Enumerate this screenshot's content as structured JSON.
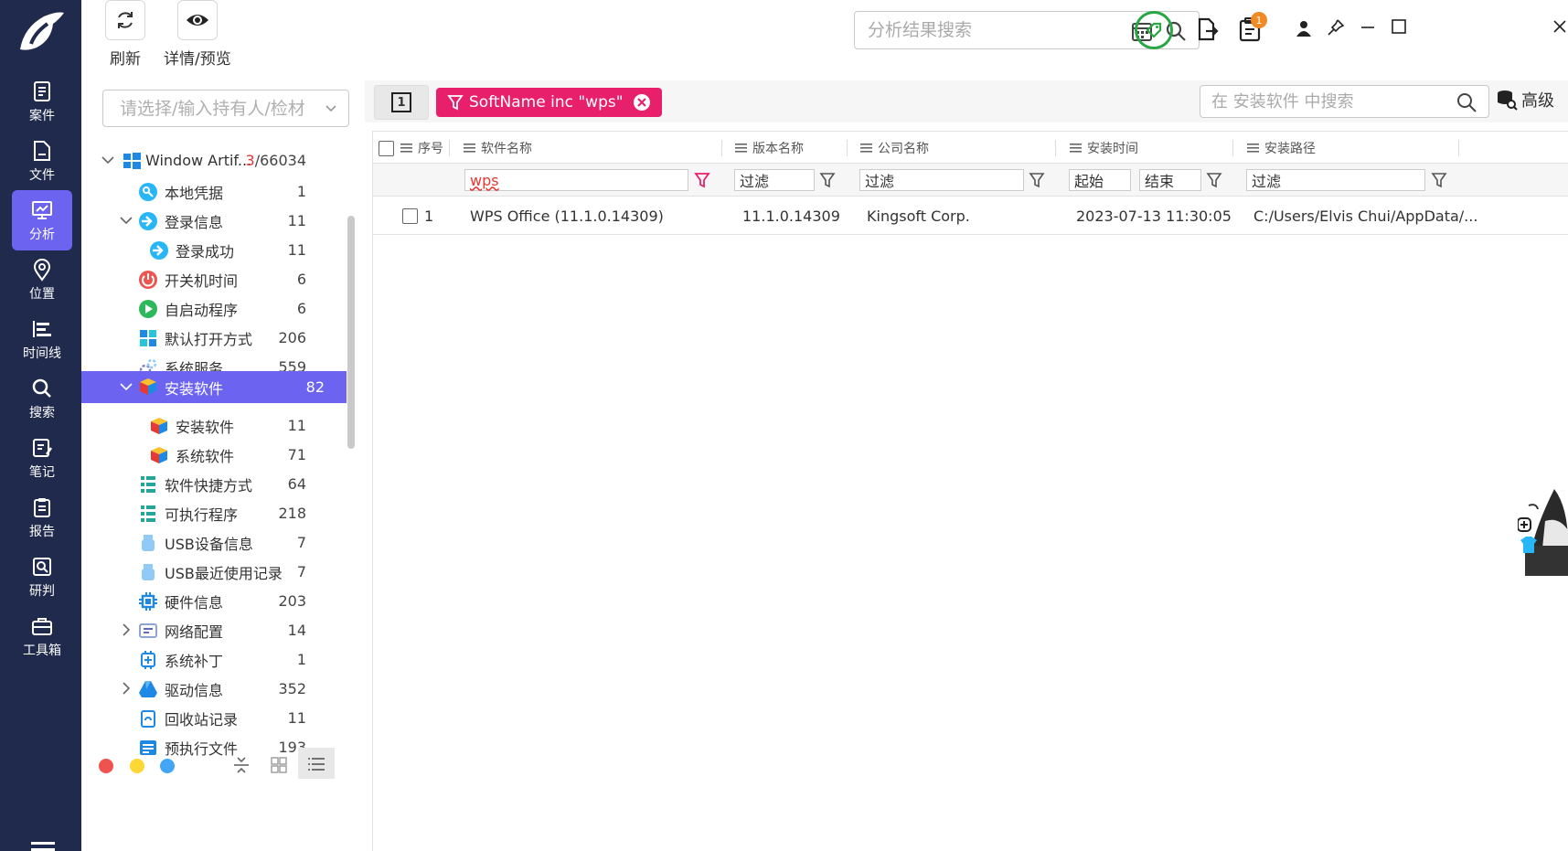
{
  "nav": {
    "items": [
      {
        "label": "案件",
        "icon": "case-icon"
      },
      {
        "label": "文件",
        "icon": "file-icon"
      },
      {
        "label": "分析",
        "icon": "analysis-icon",
        "active": true
      },
      {
        "label": "位置",
        "icon": "location-icon"
      },
      {
        "label": "时间线",
        "icon": "timeline-icon"
      },
      {
        "label": "搜索",
        "icon": "search-icon"
      },
      {
        "label": "笔记",
        "icon": "note-icon"
      },
      {
        "label": "报告",
        "icon": "report-icon"
      },
      {
        "label": "研判",
        "icon": "judge-icon"
      },
      {
        "label": "工具箱",
        "icon": "toolbox-icon"
      }
    ]
  },
  "toolbar": {
    "refresh_label": "刷新",
    "preview_label": "详情/预览",
    "search_placeholder": "分析结果搜索",
    "notification_count": "1"
  },
  "tree": {
    "holder_placeholder": "请选择/输入持有人/检材",
    "root": {
      "label": "Window Artif...",
      "count_highlight": "3",
      "count_rest": "/66034"
    },
    "items": [
      {
        "label": "本地凭据",
        "count": "1"
      },
      {
        "label": "登录信息",
        "count": "11"
      },
      {
        "label": "登录成功",
        "count": "11"
      },
      {
        "label": "开关机时间",
        "count": "6"
      },
      {
        "label": "自启动程序",
        "count": "6"
      },
      {
        "label": "默认打开方式",
        "count": "206"
      },
      {
        "label": "系统服务",
        "count": "559"
      },
      {
        "label": "安装软件",
        "count": "82"
      },
      {
        "label": "安装软件",
        "count": "11"
      },
      {
        "label": "系统软件",
        "count": "71"
      },
      {
        "label": "软件快捷方式",
        "count": "64"
      },
      {
        "label": "可执行程序",
        "count": "218"
      },
      {
        "label": "USB设备信息",
        "count": "7"
      },
      {
        "label": "USB最近使用记录",
        "count": "7"
      },
      {
        "label": "硬件信息",
        "count": "203"
      },
      {
        "label": "网络配置",
        "count": "14"
      },
      {
        "label": "系统补丁",
        "count": "1"
      },
      {
        "label": "驱动信息",
        "count": "352"
      },
      {
        "label": "回收站记录",
        "count": "11"
      },
      {
        "label": "预执行文件",
        "count": "193"
      }
    ]
  },
  "main": {
    "page_indicator": "1",
    "filter_chip": "SoftName inc \"wps\"",
    "local_search_placeholder": "在 安装软件 中搜索",
    "advanced_label": "高级",
    "columns": [
      "序号",
      "软件名称",
      "版本名称",
      "公司名称",
      "安装时间",
      "安装路径"
    ],
    "filters": {
      "name": "wps",
      "version": "过滤",
      "company": "过滤",
      "time_start": "起始",
      "time_end": "结束",
      "path": "过滤"
    },
    "rows": [
      {
        "index": "1",
        "name": "WPS Office (11.1.0.14309)",
        "version": "11.1.0.14309",
        "company": "Kingsoft Corp.",
        "time": "2023-07-13 11:30:05",
        "path": "C:/Users/Elvis Chui/AppData/..."
      }
    ]
  }
}
